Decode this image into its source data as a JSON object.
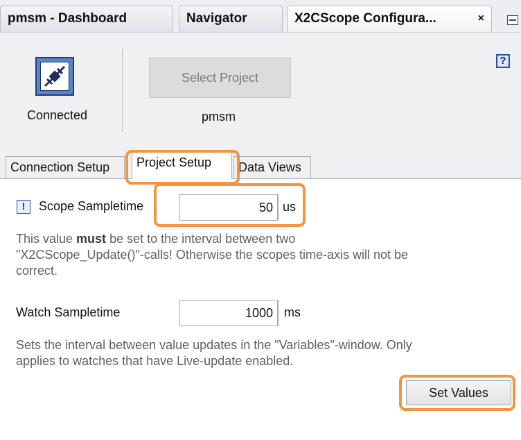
{
  "window_tabs": [
    {
      "label": "pmsm - Dashboard"
    },
    {
      "label": "Navigator"
    },
    {
      "label": "X2CScope Configura...",
      "close": "×"
    }
  ],
  "help": {
    "glyph": "?",
    "icon": "help-icon"
  },
  "connection": {
    "status": "Connected",
    "icon": "connected-plug-icon"
  },
  "project": {
    "button_label": "Select Project",
    "name": "pmsm"
  },
  "tabs": [
    {
      "label": "Connection Setup"
    },
    {
      "label": "Project Setup",
      "active": true
    },
    {
      "label": "Data Views"
    }
  ],
  "scope": {
    "label": "Scope Sampletime",
    "value": "50",
    "unit": "us",
    "warning_icon": "exclamation-icon",
    "note_prefix": "This value ",
    "note_emphasis": "must",
    "note_line1_rest": " be set to the interval between two",
    "note_line2": "\"X2CScope_Update()\"-calls! Otherwise the scopes time-axis will not be",
    "note_line3": "correct."
  },
  "watch": {
    "label": "Watch Sampletime",
    "value": "1000",
    "unit": "ms",
    "note_line1": "Sets the interval between value updates in the \"Variables\"-window. Only",
    "note_line2": "applies to watches that have Live-update enabled."
  },
  "set_values_label": "Set Values",
  "colors": {
    "highlight": "#f1953f",
    "accent": "#2a4fa0"
  }
}
